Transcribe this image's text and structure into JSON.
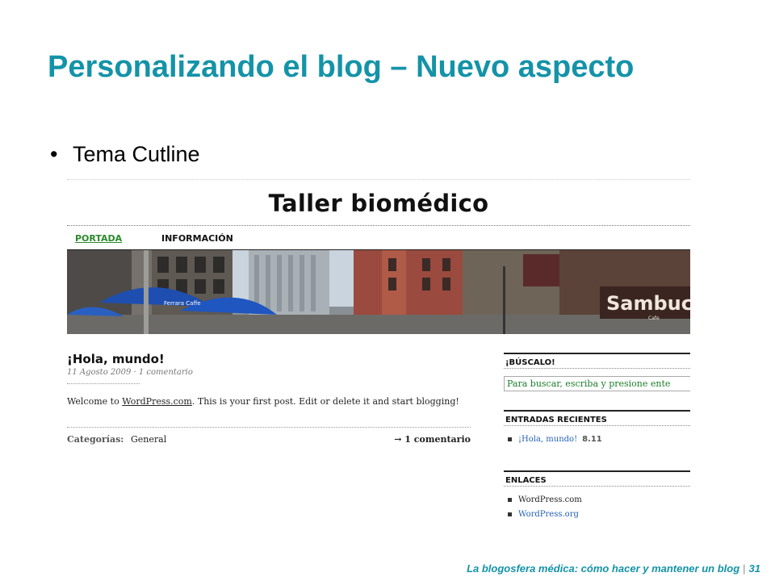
{
  "slide": {
    "title": "Personalizando el blog – Nuevo aspecto",
    "bullet": "Tema Cutline",
    "footer": "La blogosfera médica: cómo hacer y mantener un blog",
    "page_number": "31"
  },
  "blog": {
    "title": "Taller biomédico",
    "nav": [
      "PORTADA",
      "INFORMACIÓN"
    ],
    "header_image_text": [
      "Ferrara Caffe",
      "Sambuca",
      "Cafe"
    ],
    "post": {
      "title": "¡Hola, mundo!",
      "meta": "11 Agosto 2009 · 1 comentario",
      "body_prefix": "Welcome to ",
      "body_link": "WordPress.com",
      "body_suffix": ". This is your first post. Edit or delete it and start blogging!",
      "categories_label": "Categorías:",
      "categories_value": "General",
      "comments_link": "→ 1 comentario"
    },
    "sidebar": {
      "search_heading": "¡BÚSCALO!",
      "search_placeholder": "Para buscar, escriba y presione ente",
      "recent_heading": "ENTRADAS RECIENTES",
      "recent_items": [
        {
          "title": "¡Hola, mundo!",
          "date": "8.11"
        }
      ],
      "links_heading": "ENLACES",
      "links": [
        "WordPress.com",
        "WordPress.org"
      ]
    }
  },
  "colors": {
    "accent": "#1493a8",
    "nav_active": "#2b8a2b",
    "link": "#2460b8",
    "search_text": "#1a7d2a"
  }
}
